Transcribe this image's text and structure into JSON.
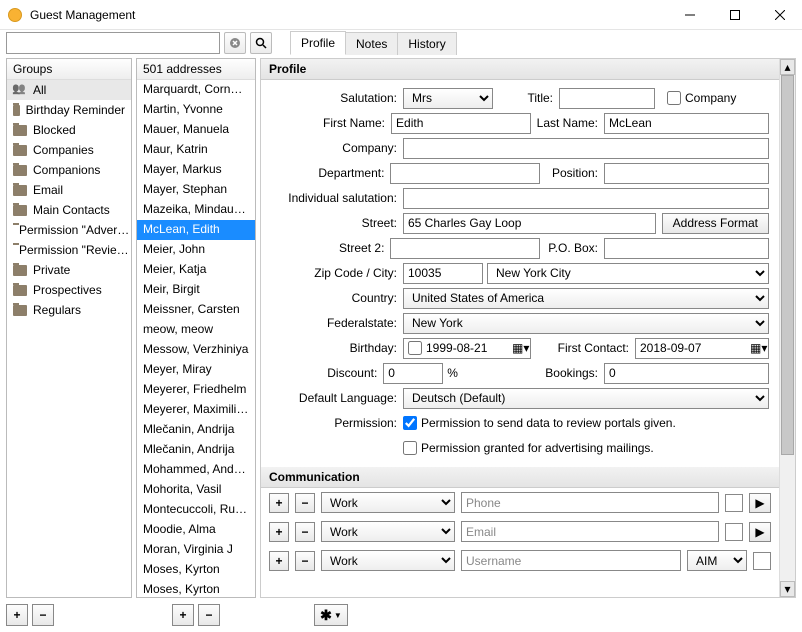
{
  "window": {
    "title": "Guest Management"
  },
  "search": {
    "placeholder": ""
  },
  "tabs": [
    "Profile",
    "Notes",
    "History"
  ],
  "activeTab": 0,
  "groups": {
    "header": "Groups",
    "items": [
      {
        "label": "All",
        "icon": "people",
        "selected": true
      },
      {
        "label": "Birthday Reminder",
        "icon": "folder"
      },
      {
        "label": "Blocked",
        "icon": "folder"
      },
      {
        "label": "Companies",
        "icon": "folder"
      },
      {
        "label": "Companions",
        "icon": "folder"
      },
      {
        "label": "Email",
        "icon": "folder"
      },
      {
        "label": "Main Contacts",
        "icon": "folder"
      },
      {
        "label": "Permission \"Adver…",
        "icon": "folder"
      },
      {
        "label": "Permission \"Revie…",
        "icon": "folder"
      },
      {
        "label": "Private",
        "icon": "folder"
      },
      {
        "label": "Prospectives",
        "icon": "folder"
      },
      {
        "label": "Regulars",
        "icon": "folder"
      }
    ]
  },
  "addresses": {
    "header": "501 addresses",
    "items": [
      "Marquardt, Cornelia",
      "Martin, Yvonne",
      "Mauer, Manuela",
      "Maur, Katrin",
      "Mayer, Markus",
      "Mayer, Stephan",
      "Mazeika, Mindaugas",
      "McLean, Edith",
      "Meier, John",
      "Meier, Katja",
      "Meir, Birgit",
      "Meissner, Carsten",
      "meow, meow",
      "Messow, Verzhiniya",
      "Meyer, Miray",
      "Meyerer, Friedhelm",
      "Meyerer, Maximili…",
      "Mlečanin, Andrija",
      "Mlečanin, Andrija",
      "Mohammed, Andr…",
      "Mohorita, Vasil",
      "Montecuccoli, Rud…",
      "Moodie, Alma",
      "Moran, Virginia J",
      "Moses, Kyrton",
      "Moses, Kyrton"
    ],
    "selectedIndex": 7
  },
  "profile": {
    "section": "Profile",
    "labels": {
      "salutation": "Salutation:",
      "title": "Title:",
      "company_cb": "Company",
      "firstname": "First Name:",
      "lastname": "Last Name:",
      "company": "Company:",
      "department": "Department:",
      "position": "Position:",
      "indiv": "Individual salutation:",
      "street": "Street:",
      "addrfmt": "Address Format",
      "street2": "Street 2:",
      "pobox": "P.O. Box:",
      "zipcity": "Zip Code / City:",
      "country": "Country:",
      "state": "Federalstate:",
      "birthday": "Birthday:",
      "firstcontact": "First Contact:",
      "discount": "Discount:",
      "percent": "%",
      "bookings": "Bookings:",
      "lang": "Default Language:",
      "perm": "Permission:",
      "perm1": "Permission to send data to review portals given.",
      "perm2": "Permission granted for advertising mailings."
    },
    "values": {
      "salutation": "Mrs",
      "title": "",
      "firstname": "Edith",
      "lastname": "McLean",
      "company": "",
      "department": "",
      "position": "",
      "indiv": "",
      "street": "65 Charles Gay Loop",
      "street2": "",
      "pobox": "",
      "zip": "10035",
      "city": "New York City",
      "country": "United States of America",
      "state": "New York",
      "birthday": "1999-08-21",
      "firstcontact": "2018-09-07",
      "discount": "0",
      "bookings": "0",
      "lang": "Deutsch (Default)",
      "perm1_checked": true,
      "perm2_checked": false,
      "birthday_checked": false
    }
  },
  "communication": {
    "section": "Communication",
    "rows": [
      {
        "type": "Work",
        "placeholder": "Phone",
        "service": ""
      },
      {
        "type": "Work",
        "placeholder": "Email",
        "service": ""
      },
      {
        "type": "Work",
        "placeholder": "Username",
        "service": "AIM"
      }
    ]
  }
}
